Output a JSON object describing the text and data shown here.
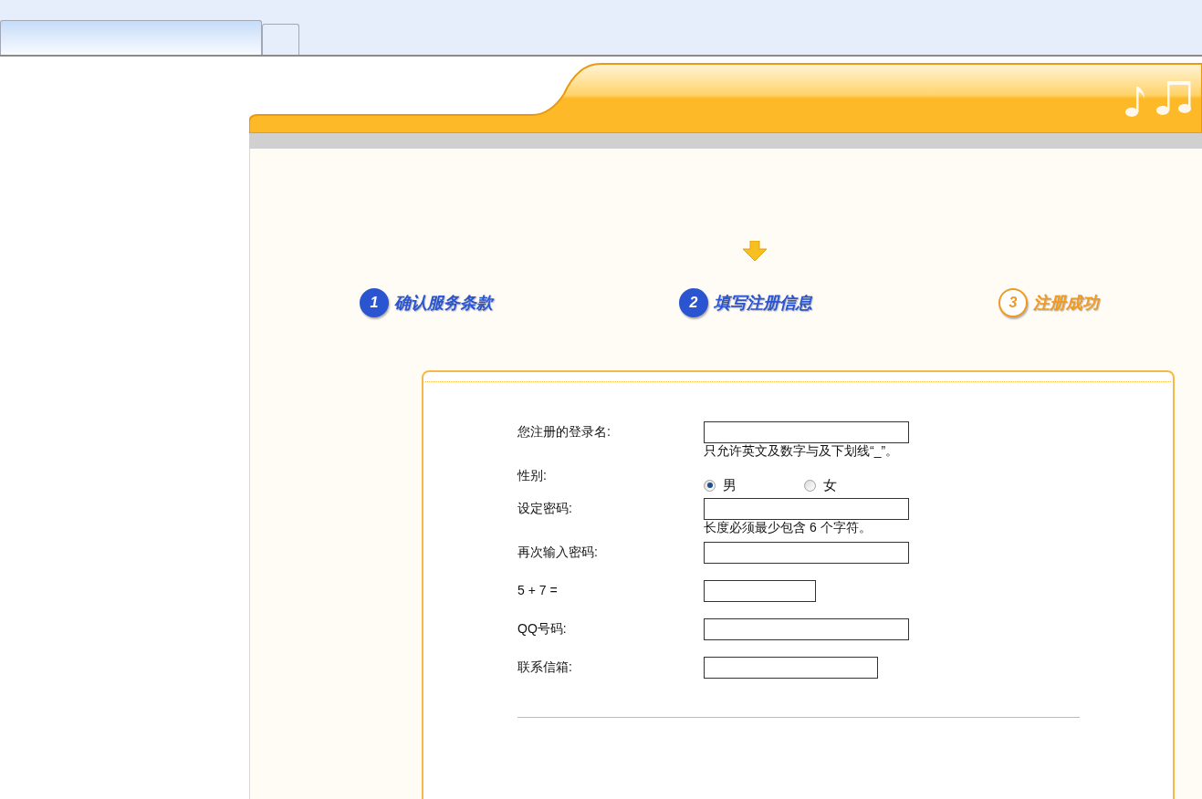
{
  "browser_tabs": [
    {
      "selected": true
    },
    {
      "selected": false
    }
  ],
  "steps": [
    {
      "number": "1",
      "label": "确认服务条款",
      "color": "#2b55d0",
      "selected": false
    },
    {
      "number": "2",
      "label": "填写注册信息",
      "color": "#2b55d0",
      "selected": true
    },
    {
      "number": "3",
      "label": "注册成功",
      "color": "#f09a20",
      "selected": false
    }
  ],
  "form": {
    "fields": [
      {
        "kind": "text",
        "label": "您注册的登录名:",
        "hint": "只允许英文及数字与及下划线“_”。"
      },
      {
        "kind": "radio",
        "label": "性别:",
        "options": [
          {
            "label": "男",
            "selected": true
          },
          {
            "label": "女",
            "selected": false
          }
        ]
      },
      {
        "kind": "text",
        "label": "设定密码:",
        "hint": "长度必须最少包含 6 个字符。"
      },
      {
        "kind": "text",
        "label": "再次输入密码:"
      },
      {
        "kind": "narrow-text",
        "label": "5 + 7 ="
      },
      {
        "kind": "text",
        "label": "QQ号码:"
      },
      {
        "kind": "medium-text",
        "label": "联系信箱:"
      }
    ]
  }
}
